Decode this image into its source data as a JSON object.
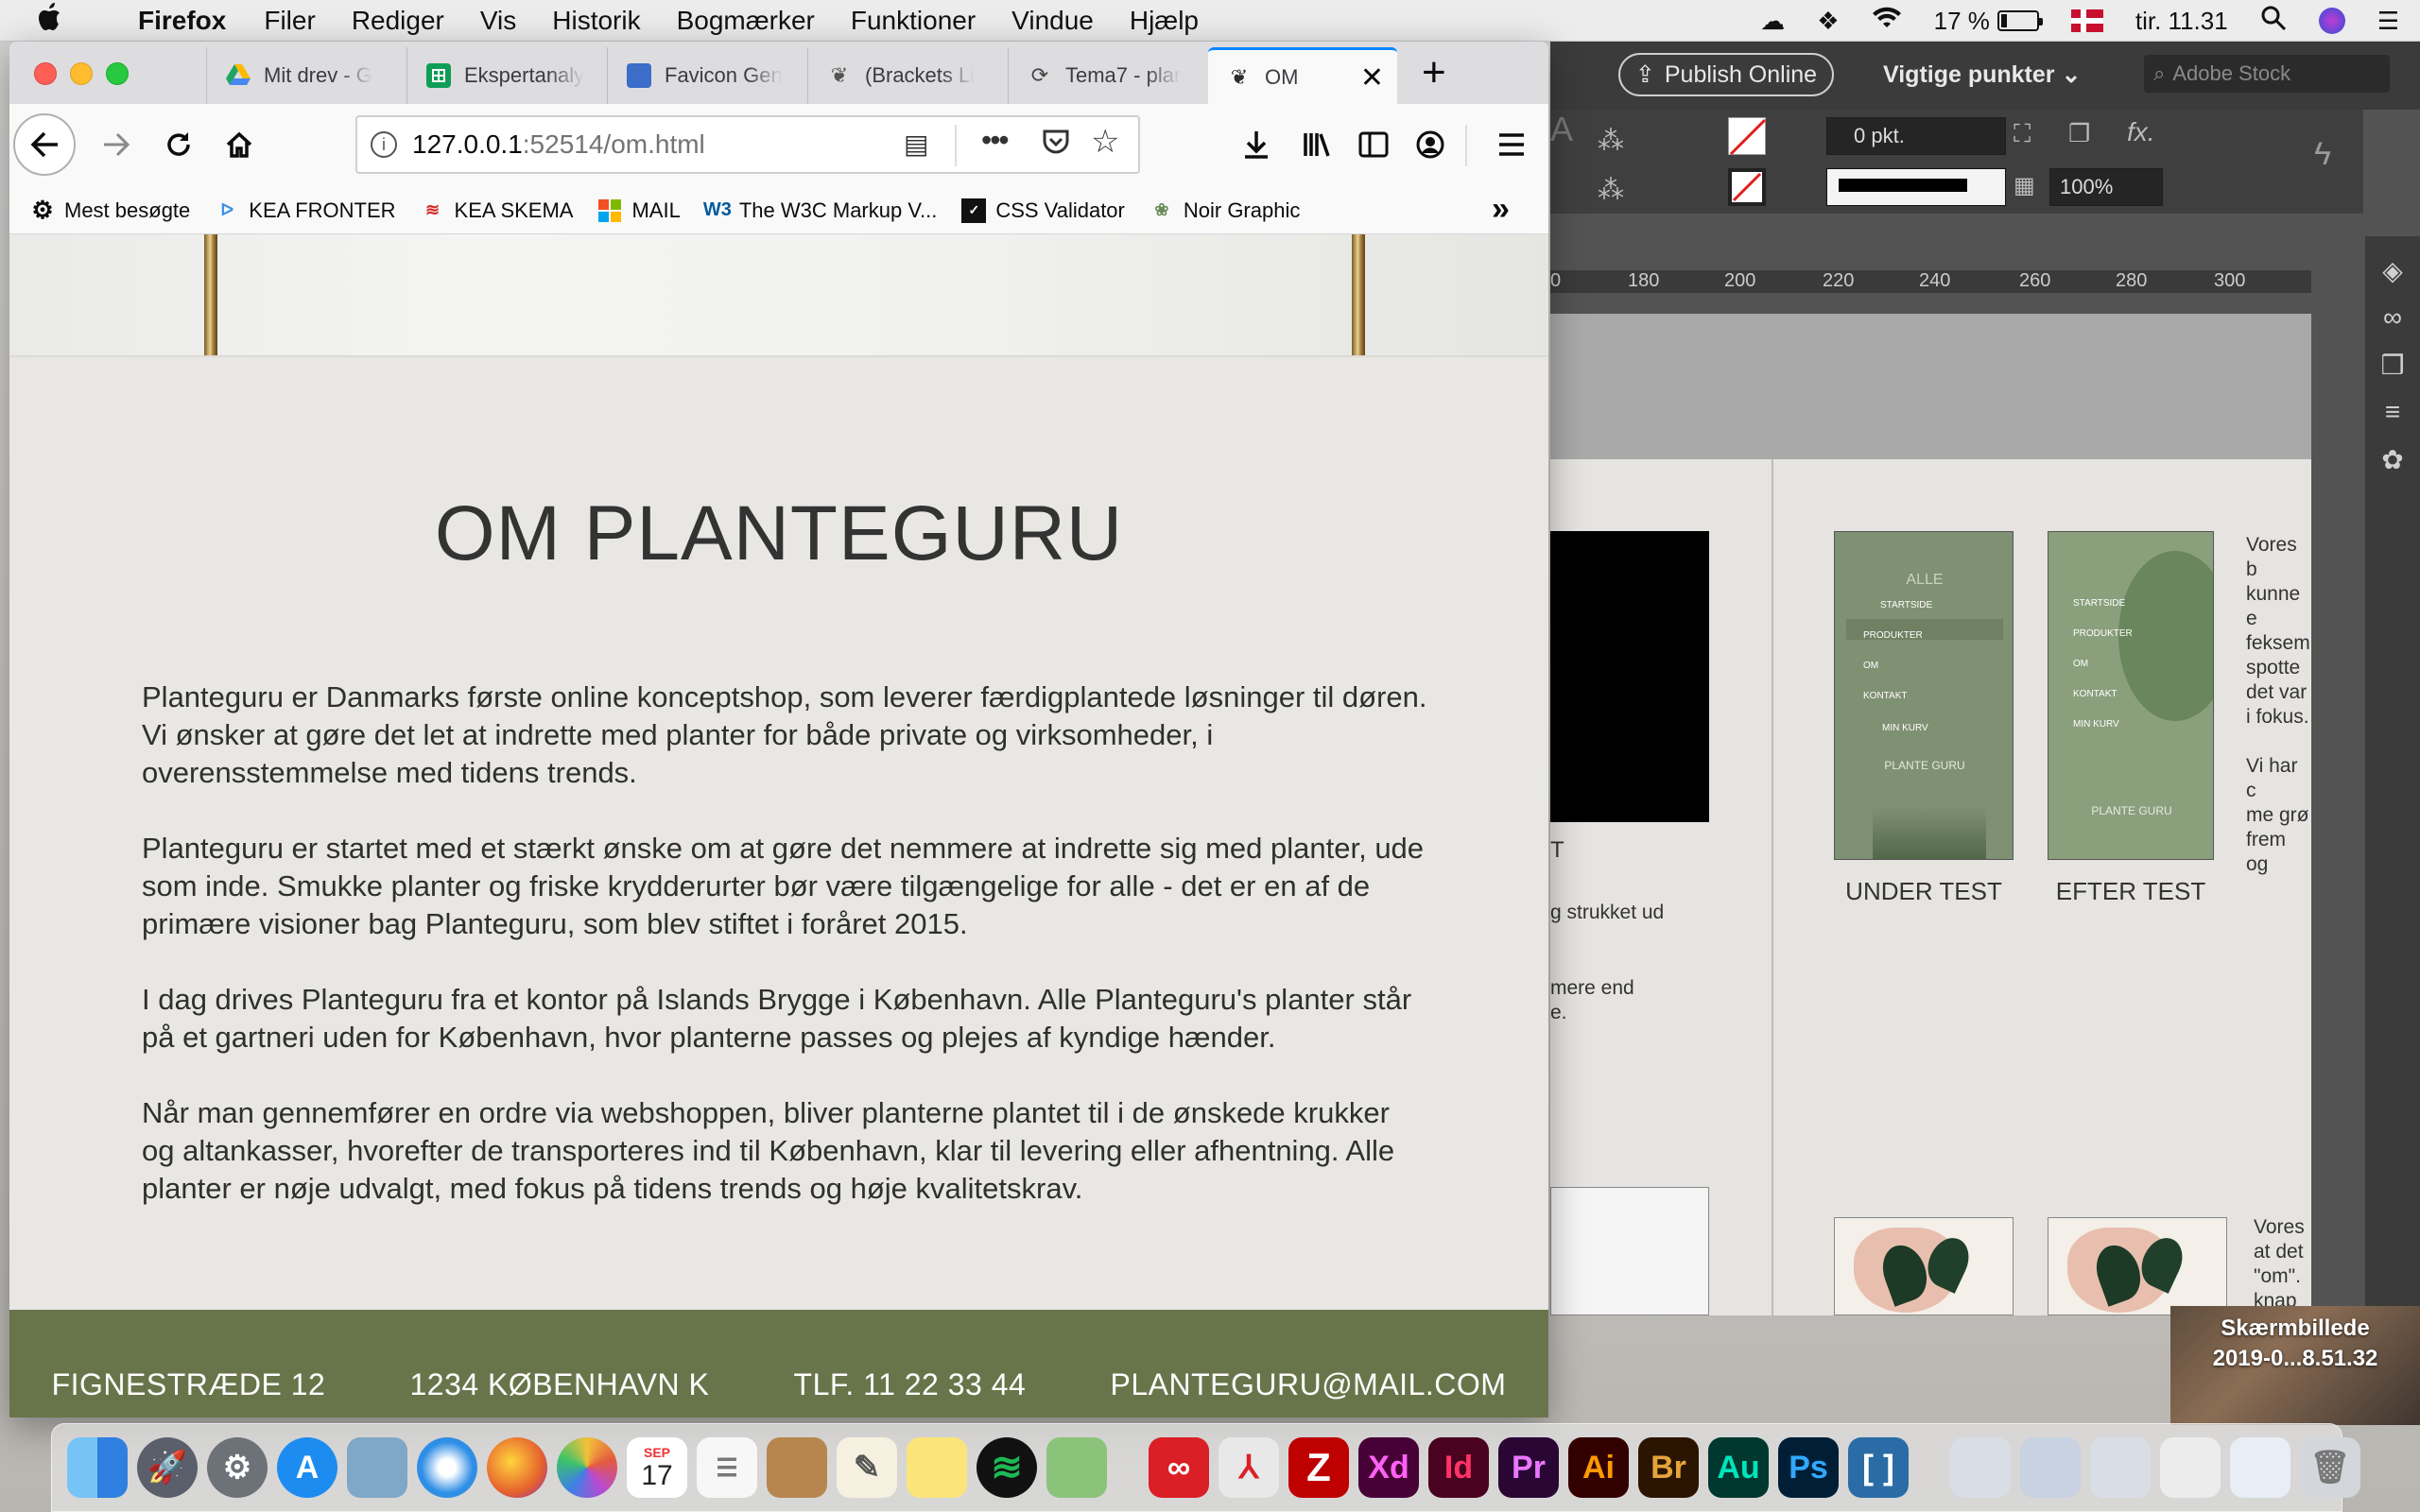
{
  "menubar": {
    "app_name": "Firefox",
    "items": [
      "Filer",
      "Rediger",
      "Vis",
      "Historik",
      "Bogmærker",
      "Funktioner",
      "Vindue",
      "Hjælp"
    ],
    "battery": "17 %",
    "clock": "tir. 11.31"
  },
  "browser": {
    "tabs": [
      {
        "label": "Mit drev - G",
        "icon": "google-drive-icon",
        "color": "#1fa463"
      },
      {
        "label": "Ekspertanaly",
        "icon": "sheets-icon",
        "color": "#0f9d58"
      },
      {
        "label": "Favicon Gen",
        "icon": "favicon-generator-icon",
        "color": "#3b6dc9"
      },
      {
        "label": "(Brackets Li",
        "icon": "brackets-leaf-icon",
        "color": "#555555"
      },
      {
        "label": "Tema7 - plar",
        "icon": "tema-icon",
        "color": "#444444"
      },
      {
        "label": "OM",
        "icon": "leaf-favicon-icon",
        "color": "#2e2e2e"
      }
    ],
    "url": {
      "host": "127.0.0.1",
      "rest": ":52514/om.html"
    },
    "bookmarks": [
      {
        "label": "Mest besøgte",
        "icon": "gear-icon"
      },
      {
        "label": "KEA FRONTER",
        "icon": "kea-fronter-icon"
      },
      {
        "label": "KEA SKEMA",
        "icon": "kea-skema-icon"
      },
      {
        "label": "MAIL",
        "icon": "microsoft-icon"
      },
      {
        "label": "The W3C Markup V...",
        "icon": "w3c-icon"
      },
      {
        "label": "CSS Validator",
        "icon": "css-validator-icon"
      },
      {
        "label": "Noir Graphic",
        "icon": "noir-graphic-icon"
      }
    ]
  },
  "page": {
    "title": "OM PLANTEGURU",
    "paragraphs": [
      "Planteguru er Danmarks første online konceptshop, som leverer færdigplantede løsninger til døren. Vi ønsker at gøre det let at indrette med planter for både private og virksomheder, i overensstemmelse med tidens trends.",
      "Planteguru er startet med et stærkt ønske om at gøre det nemmere at indrette sig med planter, ude som inde. Smukke planter og friske krydderurter bør være tilgængelige for alle - det er en af de primære visioner bag Planteguru, som blev stiftet i foråret 2015.",
      "I dag drives Planteguru fra et kontor på Islands Brygge i København. Alle Planteguru's planter står på et gartneri uden for København, hvor planterne passes og plejes af kyndige hænder.",
      "Når man gennemfører en ordre via webshoppen, bliver planterne plantet til i de ønskede krukker og altankasser, hvorefter de transporteres ind til København, klar til levering eller afhentning. Alle planter er nøje udvalgt, med fokus på tidens trends og høje kvalitetskrav."
    ],
    "footer": {
      "address": "FIGNESTRÆDE 12",
      "city": "1234 KØBENHAVN K",
      "phone": "TLF. 11 22 33 44",
      "email": "PLANTEGURU@MAIL.COM"
    },
    "footer_color": "#68754a",
    "background_color": "#e8e7e3"
  },
  "indesign": {
    "publish_label": "Publish Online",
    "workspace_label": "Vigtige punkter",
    "stock_placeholder": "Adobe Stock",
    "stroke_weight": "0 pkt.",
    "zoom": "100%",
    "ruler_ticks": [
      "0",
      "180",
      "200",
      "220",
      "240",
      "260",
      "280",
      "300"
    ],
    "captions": [
      "UNDER TEST",
      "EFTER TEST"
    ],
    "phone_menu_under": [
      "ALLE",
      "STARTSIDE",
      "PRODUKTER",
      "OM",
      "KONTAKT",
      "MIN KURV"
    ],
    "phone_menu_after": [
      "STARTSIDE",
      "PRODUKTER",
      "OM",
      "KONTAKT",
      "MIN KURV"
    ],
    "phone_logo": "PLANTE GURU",
    "partial_text_left": [
      "T",
      "g strukket ud",
      "mere end",
      "e."
    ],
    "partial_text_right_top": [
      "Vores b",
      "kunne e",
      "feksem",
      "spotte",
      "det var",
      "i fokus.",
      "",
      "Vi har c",
      "me grø",
      "frem og"
    ],
    "partial_text_right_bottom": [
      "Vores",
      "at det",
      "\"om\".",
      "knap"
    ]
  },
  "desktop": {
    "screenshot_label_line1": "Skærmbillede",
    "screenshot_label_line2": "2019-0...8.51.32"
  },
  "dock": {
    "calendar_month": "SEP",
    "calendar_day": "17",
    "apps": [
      {
        "name": "finder-icon",
        "color": "#3b8ee8",
        "glyph": ""
      },
      {
        "name": "launchpad-icon",
        "color": "#5a5f6b",
        "glyph": ""
      },
      {
        "name": "system-preferences-icon",
        "color": "#6d7178",
        "glyph": ""
      },
      {
        "name": "app-store-icon",
        "color": "#1c8cf0",
        "glyph": ""
      },
      {
        "name": "preview-icon",
        "color": "#7fa7c7",
        "glyph": ""
      },
      {
        "name": "safari-icon",
        "color": "#2f8ee6",
        "glyph": ""
      },
      {
        "name": "firefox-icon",
        "color": "#e6622d",
        "glyph": ""
      },
      {
        "name": "photos-icon",
        "color": "#f2f2f2",
        "glyph": ""
      },
      {
        "name": "calendar-icon",
        "color": "#ffffff",
        "glyph": ""
      },
      {
        "name": "reminders-icon",
        "color": "#f7f7f7",
        "glyph": ""
      },
      {
        "name": "notebook-icon",
        "color": "#b7864f",
        "glyph": ""
      },
      {
        "name": "textedit-icon",
        "color": "#f5f0e0",
        "glyph": ""
      },
      {
        "name": "notes-icon",
        "color": "#fbe47a",
        "glyph": ""
      },
      {
        "name": "spotify-icon",
        "color": "#1db954",
        "glyph": ""
      },
      {
        "name": "maps-icon",
        "color": "#8bc37a",
        "glyph": ""
      },
      {
        "name": "creative-cloud-icon",
        "color": "#da1f26",
        "glyph": ""
      },
      {
        "name": "acrobat-icon",
        "color": "#e8e8e8",
        "glyph": ""
      },
      {
        "name": "filezilla-icon",
        "color": "#bf0000",
        "glyph": ""
      },
      {
        "name": "adobe-xd-icon",
        "color": "#470137",
        "glyph": "Xd"
      },
      {
        "name": "adobe-indesign-icon",
        "color": "#49021f",
        "glyph": "Id"
      },
      {
        "name": "adobe-premiere-icon",
        "color": "#2a0634",
        "glyph": "Pr"
      },
      {
        "name": "adobe-illustrator-icon",
        "color": "#330000",
        "glyph": "Ai"
      },
      {
        "name": "adobe-bridge-icon",
        "color": "#2b1500",
        "glyph": "Br"
      },
      {
        "name": "adobe-audition-icon",
        "color": "#00382f",
        "glyph": "Au"
      },
      {
        "name": "adobe-photoshop-icon",
        "color": "#001e36",
        "glyph": "Ps"
      },
      {
        "name": "brackets-icon",
        "color": "#2b6ca6",
        "glyph": ""
      }
    ]
  }
}
